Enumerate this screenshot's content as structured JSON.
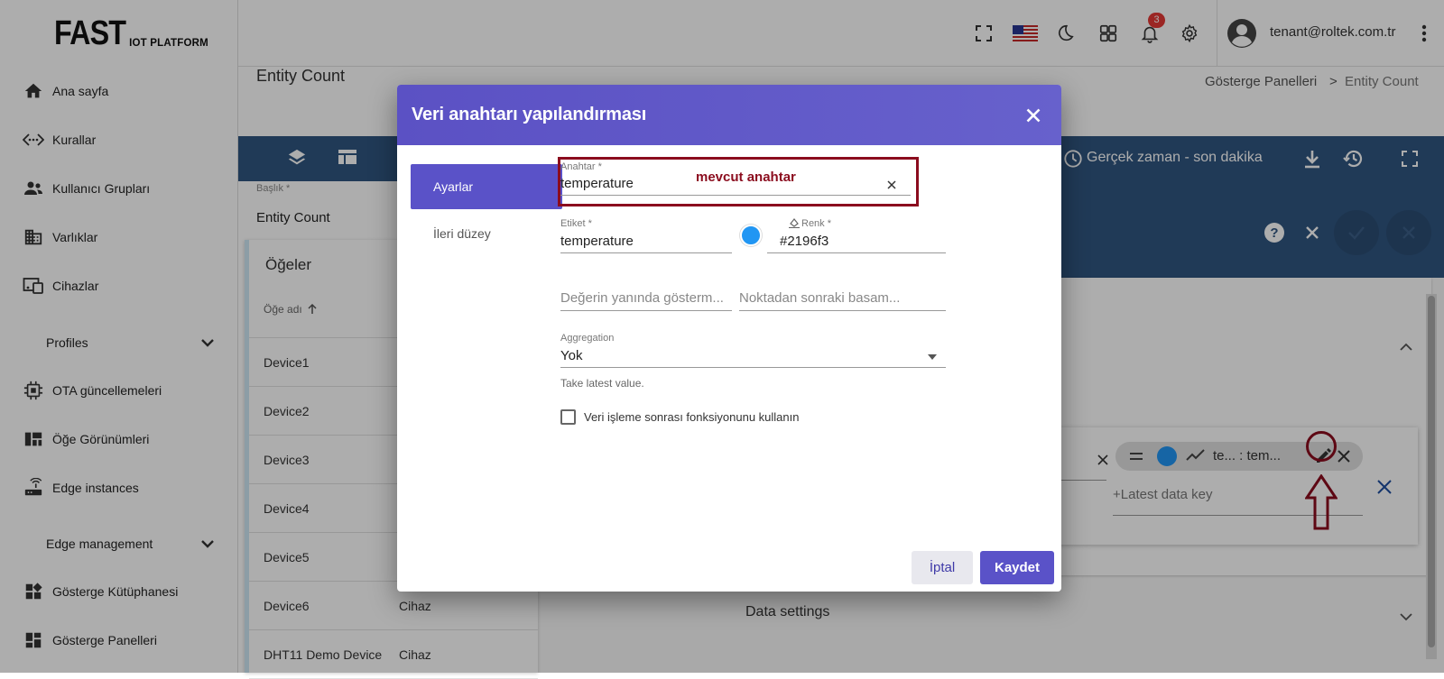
{
  "app": {
    "logo_main": "FAST",
    "logo_sub": "IOT PLATFORM"
  },
  "sidebar": {
    "items": [
      {
        "label": "Ana sayfa",
        "icon": "home-icon"
      },
      {
        "label": "Kurallar",
        "icon": "code-dots-icon"
      },
      {
        "label": "Kullanıcı Grupları",
        "icon": "users-icon"
      },
      {
        "label": "Varlıklar",
        "icon": "building-icon"
      },
      {
        "label": "Cihazlar",
        "icon": "devices-icon"
      },
      {
        "label": "Profiles",
        "icon": "chevron-down-icon"
      },
      {
        "label": "OTA güncellemeleri",
        "icon": "chip-icon"
      },
      {
        "label": "Öğe Görünümleri",
        "icon": "view-quilt-icon"
      },
      {
        "label": "Edge instances",
        "icon": "router-icon"
      },
      {
        "label": "Edge management",
        "icon": "chevron-down-icon"
      },
      {
        "label": "Gösterge Kütüphanesi",
        "icon": "widgets-icon"
      },
      {
        "label": "Gösterge Panelleri",
        "icon": "dashboard-icon"
      }
    ]
  },
  "topbar": {
    "notifications_count": "3",
    "user_email": "tenant@roltek.com.tr"
  },
  "page": {
    "title": "Entity Count",
    "breadcrumb": [
      "Gösterge Panelleri",
      ">",
      "Entity Count"
    ]
  },
  "toolbar": {
    "realtime_label": "Gerçek zaman - son dakika"
  },
  "widget_settings": {
    "title_label": "Başlık *",
    "title_value": "Entity Count",
    "latest_key_placeholder": "+Latest data key",
    "chip_text": "te... : tem...",
    "data_settings_label": "Data settings"
  },
  "entities_card": {
    "title": "Öğeler",
    "column_name": "Öğe adı",
    "rows": [
      {
        "name": "Device1",
        "type": ""
      },
      {
        "name": "Device2",
        "type": ""
      },
      {
        "name": "Device3",
        "type": ""
      },
      {
        "name": "Device4",
        "type": ""
      },
      {
        "name": "Device5",
        "type": ""
      },
      {
        "name": "Device6",
        "type": "Cihaz"
      },
      {
        "name": "DHT11 Demo Device",
        "type": "Cihaz"
      }
    ]
  },
  "dialog": {
    "title": "Veri anahtarı yapılandırması",
    "tabs": [
      "Ayarlar",
      "İleri düzey"
    ],
    "key_label": "Anahtar *",
    "key_value": "temperature",
    "annotation": "mevcut anahtar",
    "label_label": "Etiket *",
    "label_value": "temperature",
    "color_label": "Renk *",
    "color_value": "#2196f3",
    "units_placeholder": "Değerin yanında gösterm...",
    "decimals_placeholder": "Noktadan sonraki basam...",
    "aggregation_label": "Aggregation",
    "aggregation_value": "Yok",
    "aggregation_hint": "Take latest value.",
    "postprocess_label": "Veri işleme sonrası fonksiyonunu kullanın",
    "cancel": "İptal",
    "save": "Kaydet"
  },
  "colors": {
    "accent": "#5a52c8",
    "toolbar": "#305680",
    "annotation": "#8b0c1e",
    "chip_color": "#2196f3"
  }
}
